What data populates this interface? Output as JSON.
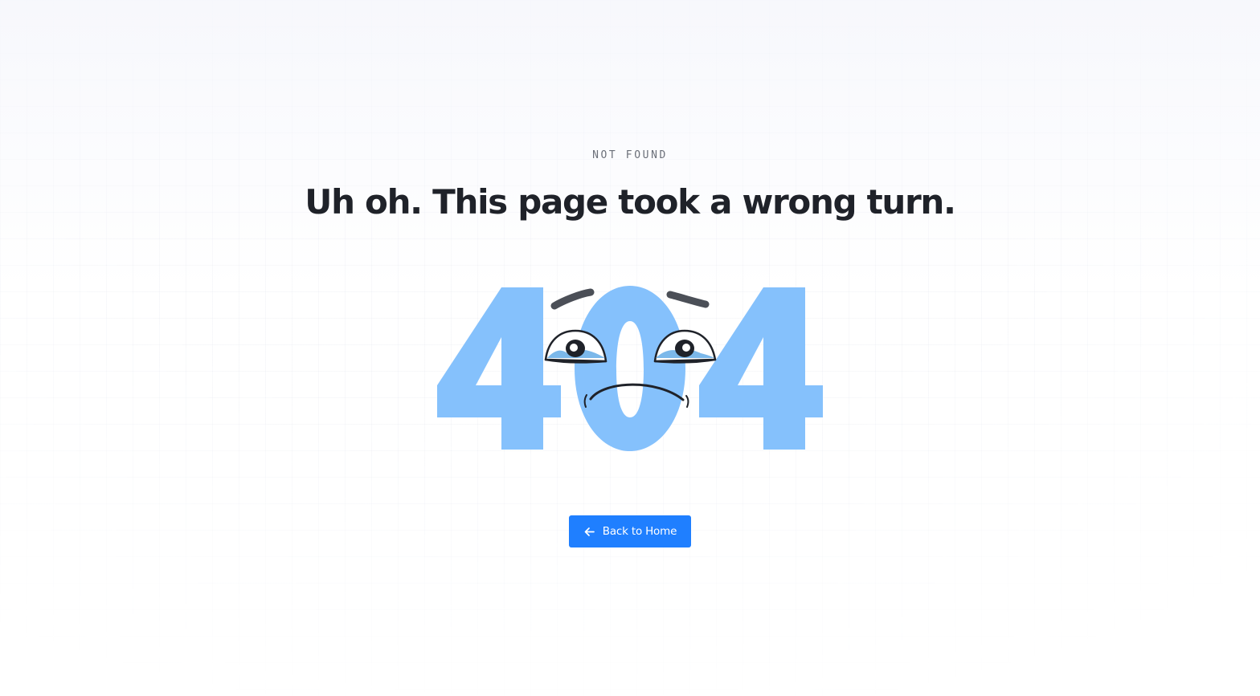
{
  "eyebrow": "NOT FOUND",
  "headline": "Uh oh. This page took a wrong turn.",
  "illustration": {
    "digits": [
      "4",
      "0",
      "4"
    ],
    "face_icon": "sad-crying-face-icon"
  },
  "button": {
    "label": "Back to Home",
    "icon": "arrow-left-icon"
  },
  "colors": {
    "accent": "#1f7fff",
    "digit_blue": "#85c1fc",
    "tear_blue": "#7bb8ea",
    "headline": "#1f2229",
    "eyebrow": "#6b7079",
    "face_line": "#1f2229"
  }
}
